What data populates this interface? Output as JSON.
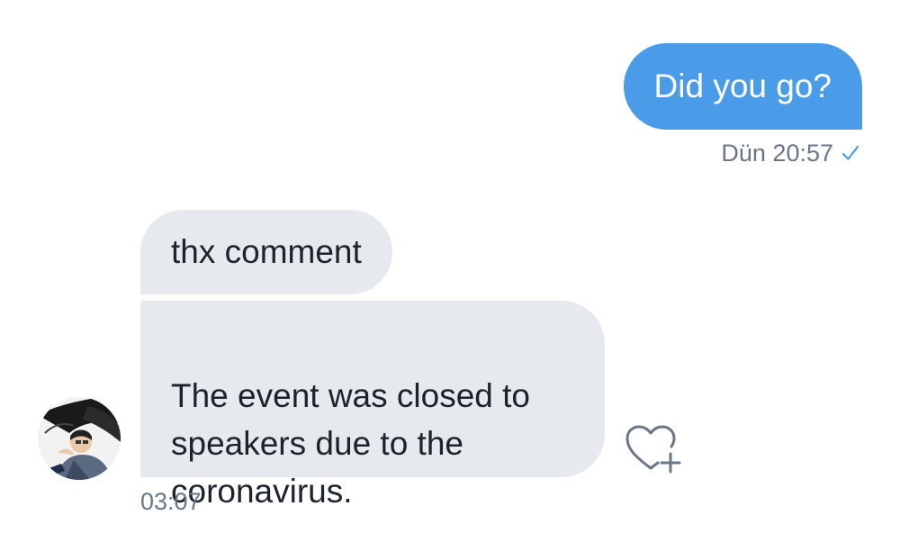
{
  "conversation": {
    "outgoing": {
      "text": "Did you go?",
      "timestamp": "Dün 20:57",
      "status_icon": "checkmark-icon",
      "bubble_color": "#4b9ce8"
    },
    "incoming": {
      "messages": [
        {
          "text": "thx comment"
        },
        {
          "text": "The event was closed to\nspeakers due to the\ncoronavirus."
        }
      ],
      "timestamp": "03:07",
      "bubble_color": "#e6e9ee",
      "avatar_icon": "avatar-illustration",
      "reaction_icon": "heart-plus-icon"
    }
  }
}
